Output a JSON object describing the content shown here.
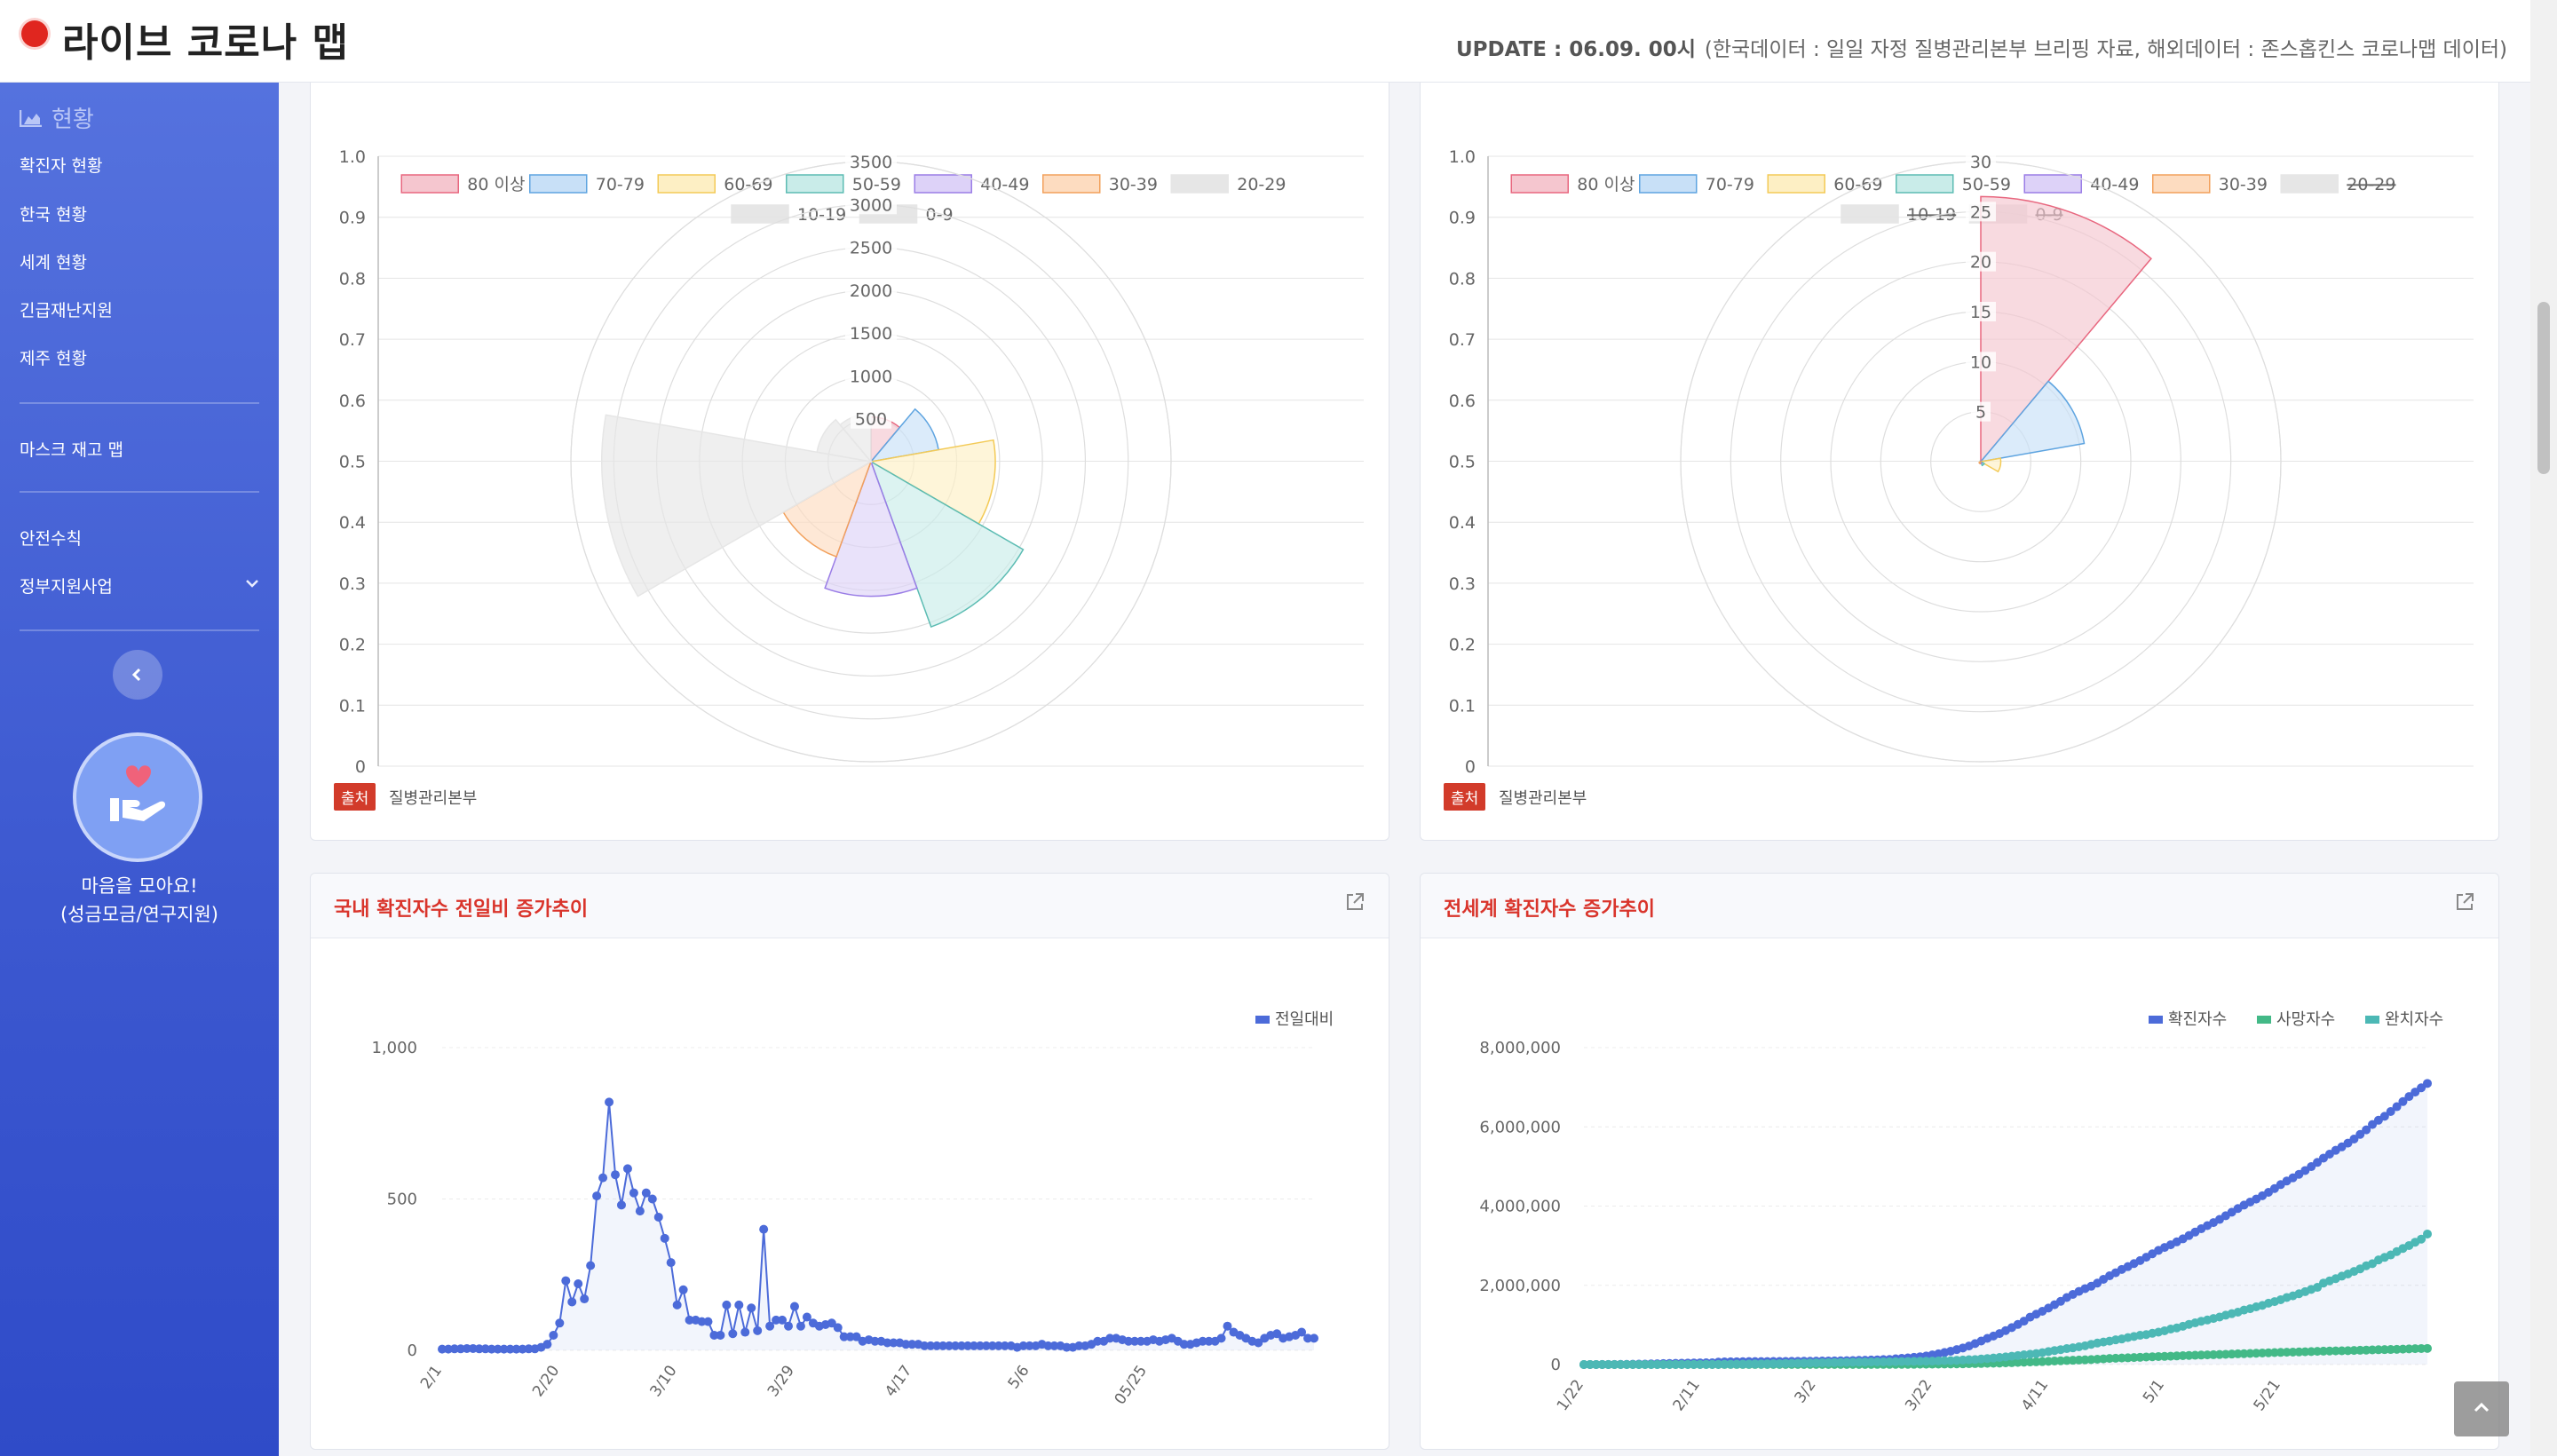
{
  "header": {
    "title": "라이브 코로나 맵",
    "update_label": "UPDATE : 06.09. 00시",
    "update_source": "(한국데이터 : 일일 자정 질병관리본부 브리핑 자료, 해외데이터 : 존스홉킨스 코로나맵 데이터)"
  },
  "sidebar": {
    "section_title": "현황",
    "items": [
      "확진자 현황",
      "한국 현황",
      "세계 현황",
      "긴급재난지원",
      "제주 현황"
    ],
    "mask_item": "마스크 재고 맵",
    "safety_item": "안전수칙",
    "gov_item": "정부지원사업",
    "collapse_icon": "chevron-left-icon",
    "donate_line1": "마음을 모아요!",
    "donate_line2": "(성금모금/연구지원)"
  },
  "colors": {
    "brand_red": "#e0261f",
    "sidebar_blue": "#3c58d0",
    "confirmed": "#4c6bd9",
    "deaths": "#43b987",
    "recovered": "#4cb8b5"
  },
  "source_badge": "출처",
  "source_name": "질병관리본부",
  "polar_legend": [
    "80 이상",
    "70-79",
    "60-69",
    "50-59",
    "40-49",
    "30-39",
    "20-29",
    "10-19",
    "0-9"
  ],
  "polar_legend_colors": [
    "#f5c6cf",
    "#c8e0f7",
    "#fdefc4",
    "#c9ece9",
    "#ddd2f8",
    "#fddcc0",
    "#e6e6e6",
    "#e6e6e6",
    "#e6e6e6"
  ],
  "polar_legend_borders": [
    "#e8677f",
    "#5ea4e0",
    "#f3ca56",
    "#5cbcb3",
    "#9a7de6",
    "#f2a05b",
    "#e6e6e6",
    "#e6e6e6",
    "#e6e6e6"
  ],
  "chart_data": [
    {
      "type": "polar",
      "title": "",
      "left_axis_ticks": [
        "0",
        "0.1",
        "0.2",
        "0.3",
        "0.4",
        "0.5",
        "0.6",
        "0.7",
        "0.8",
        "0.9",
        "1.0"
      ],
      "radial_ticks": [
        "500",
        "1000",
        "1500",
        "2000",
        "2500",
        "3000",
        "3500"
      ],
      "rmax": 3500,
      "categories": [
        "80 이상",
        "70-79",
        "60-69",
        "50-59",
        "40-49",
        "30-39",
        "20-29",
        "10-19",
        "0-9"
      ],
      "values": [
        520,
        800,
        1450,
        2050,
        1570,
        1180,
        3140,
        640,
        560
      ],
      "hidden": []
    },
    {
      "type": "polar",
      "title": "",
      "left_axis_ticks": [
        "0",
        "0.1",
        "0.2",
        "0.3",
        "0.4",
        "0.5",
        "0.6",
        "0.7",
        "0.8",
        "0.9",
        "1.0"
      ],
      "radial_ticks": [
        "5",
        "10",
        "15",
        "20",
        "25",
        "30"
      ],
      "rmax": 30,
      "categories": [
        "80 이상",
        "70-79",
        "60-69",
        "50-59",
        "40-49",
        "30-39",
        "20-29",
        "10-19",
        "0-9"
      ],
      "values": [
        26.5,
        10.5,
        2,
        0.4,
        0.2,
        0.2,
        0,
        0,
        0
      ],
      "hidden": [
        "20-29",
        "10-19",
        "0-9"
      ]
    },
    {
      "type": "line",
      "title": "국내 확진자수 전일비 증가추이",
      "series": [
        {
          "name": "전일대비",
          "values": [
            4,
            4,
            5,
            5,
            6,
            6,
            5,
            5,
            4,
            4,
            4,
            4,
            4,
            4,
            5,
            5,
            10,
            20,
            50,
            90,
            230,
            160,
            220,
            170,
            280,
            510,
            570,
            820,
            580,
            480,
            600,
            520,
            460,
            520,
            500,
            440,
            370,
            290,
            150,
            200,
            100,
            100,
            95,
            95,
            50,
            50,
            150,
            55,
            150,
            60,
            140,
            65,
            400,
            80,
            100,
            100,
            80,
            145,
            80,
            110,
            90,
            80,
            85,
            90,
            75,
            45,
            45,
            45,
            30,
            35,
            30,
            30,
            25,
            25,
            25,
            20,
            20,
            20,
            15,
            15,
            15,
            15,
            15,
            15,
            15,
            15,
            15,
            15,
            15,
            15,
            15,
            15,
            15,
            10,
            15,
            15,
            15,
            20,
            15,
            15,
            15,
            10,
            10,
            15,
            15,
            20,
            30,
            30,
            40,
            40,
            35,
            30,
            30,
            30,
            30,
            35,
            30,
            35,
            40,
            30,
            20,
            20,
            25,
            30,
            30,
            30,
            40,
            80,
            60,
            50,
            40,
            30,
            25,
            40,
            50,
            55,
            40,
            45,
            50,
            60,
            40,
            40
          ]
        }
      ],
      "x_tick_labels": [
        "2/1",
        "2/20",
        "3/10",
        "3/29",
        "4/17",
        "5/6",
        "05/25"
      ],
      "y_ticks": [
        "0",
        "500",
        "1,000"
      ],
      "ylim": [
        0,
        1000
      ],
      "x_axis_units": "day-of-series"
    },
    {
      "type": "line",
      "title": "전세계 확진자수 증가추이",
      "series": [
        {
          "name": "확진자수",
          "values": [
            555,
            654,
            941,
            1434,
            2118,
            2927,
            5578,
            6166,
            8234,
            9927,
            12038,
            16787,
            19881,
            23892,
            27635,
            30794,
            34391,
            37120,
            40150,
            42762,
            44802,
            45221,
            60368,
            66885,
            69030,
            71224,
            73258,
            75136,
            75639,
            76197,
            76823,
            78579,
            78965,
            79568,
            80413,
            81395,
            82754,
            84120,
            86011,
            88369,
            90306,
            92840,
            95120,
            97886,
            101800,
            105847,
            109821,
            113590,
            118620,
            125875,
            128352,
            145205,
            156101,
            167454,
            181574,
            197102,
            214821,
            242570,
            272208,
            304507,
            336953,
            378235,
            418045,
            467653,
            529591,
            593291,
            660693,
            720140,
            782389,
            857487,
            932605,
            1013157,
            1095917,
            1197405,
            1272115,
            1345101,
            1426096,
            1511104,
            1595350,
            1691719,
            1771514,
            1846680,
            1917320,
            1976192,
            2056055,
            2152437,
            2240190,
            2317759,
            2401379,
            2472259,
            2549123,
            2624610,
            2708403,
            2795731,
            2881140,
            2955033,
            3023722,
            3097229,
            3172287,
            3256846,
            3343777,
            3427343,
            3506729,
            3583055,
            3662691,
            3755341,
            3845718,
            3938064,
            4024009,
            4101699,
            4177502,
            4261747,
            4347018,
            4442163,
            4542347,
            4634068,
            4713620,
            4801943,
            4897492,
            4996472,
            5102424,
            5210817,
            5310362,
            5407613,
            5495061,
            5589626,
            5691790,
            5808946,
            5924275,
            6059017,
            6166978,
            6265852,
            6386353,
            6509084,
            6637917,
            6764802,
            6877367,
            6986596,
            7096000
          ]
        },
        {
          "name": "사망자수",
          "values": [
            17,
            18,
            26,
            42,
            56,
            82,
            131,
            133,
            171,
            213,
            259,
            362,
            426,
            492,
            564,
            634,
            719,
            806,
            906,
            1013,
            1113,
            1118,
            1371,
            1523,
            1666,
            1770,
            1868,
            2007,
            2122,
            2247,
            2251,
            2458,
            2469,
            2629,
            2708,
            2770,
            2814,
            2872,
            2941,
            2996,
            3085,
            3160,
            3254,
            3348,
            3460,
            3558,
            3802,
            3988,
            4262,
            4615,
            4720,
            5404,
            5819,
            6440,
            7126,
            7905,
            8733,
            9867,
            11299,
            12973,
            14623,
            16497,
            18615,
            21181,
            23970,
            27198,
            30652,
            33925,
            37582,
            42107,
            46809,
            52983,
            58787,
            64606,
            69374,
            74565,
            81865,
            88338,
            95455,
            102525,
            108502,
            114090,
            119481,
            125983,
            134176,
            143800,
            153822,
            159510,
            165044,
            169986,
            176583,
            183066,
            190858,
            197159,
            202846,
            206544,
            211167,
            217153,
            224172,
            230796,
            234112,
            239740,
            243401,
            248134,
            253869,
            258366,
            264837,
            271040,
            275821,
            280250,
            285138,
            291942,
            297197,
            302418,
            307395,
            310640,
            314686,
            318481,
            323286,
            328115,
            332924,
            337687,
            341722,
            344961,
            347836,
            350453,
            355629,
            360308,
            365445,
            370657,
            374452,
            377460,
            380249,
            384444,
            389620,
            394887,
            400857,
            404396,
            407000
          ]
        },
        {
          "name": "완치자수",
          "values": [
            28,
            30,
            36,
            39,
            52,
            61,
            107,
            126,
            143,
            222,
            284,
            472,
            623,
            852,
            1124,
            1487,
            2011,
            2616,
            3244,
            3946,
            4683,
            5150,
            6295,
            8058,
            9395,
            10865,
            12583,
            14352,
            16121,
            18177,
            18890,
            22886,
            23394,
            27905,
            30384,
            33277,
            36711,
            39782,
            42716,
            45602,
            48228,
            51170,
            53796,
            55865,
            58358,
            60694,
            62494,
            64404,
            67003,
            68324,
            70251,
            72624,
            76034,
            78088,
            80840,
            83207,
            84854,
            87256,
            91449,
            97704,
            98355,
            107701,
            113787,
            122150,
            126998,
            141183,
            152073,
            164566,
            178034,
            193177,
            210263,
            225796,
            246152,
            260012,
            276515,
            300054,
            328661,
            353975,
            376096,
            402110,
            421722,
            448655,
            474261,
            511019,
            542107,
            568343,
            592319,
            623903,
            645738,
            680400,
            709694,
            738486,
            755889,
            789014,
            817642,
            852382,
            895645,
            924279,
            966087,
            1014753,
            1052415,
            1093112,
            1125236,
            1162724,
            1198832,
            1245413,
            1284741,
            1322050,
            1375624,
            1408980,
            1456209,
            1493414,
            1548547,
            1587893,
            1637067,
            1693197,
            1733963,
            1786875,
            1838995,
            1897466,
            1948739,
            2056643,
            2112185,
            2168563,
            2231738,
            2286956,
            2350088,
            2415214,
            2493934,
            2546412,
            2640110,
            2704590,
            2766500,
            2852410,
            2931000,
            3004000,
            3088000,
            3166000,
            3295000
          ]
        }
      ],
      "x_tick_labels": [
        "1/22",
        "2/11",
        "3/2",
        "3/22",
        "4/11",
        "5/1",
        "5/21"
      ],
      "y_ticks": [
        "0",
        "2,000,000",
        "4,000,000",
        "6,000,000",
        "8,000,000"
      ],
      "ylim": [
        0,
        8000000
      ],
      "x_axis_units": "day-of-series"
    }
  ]
}
